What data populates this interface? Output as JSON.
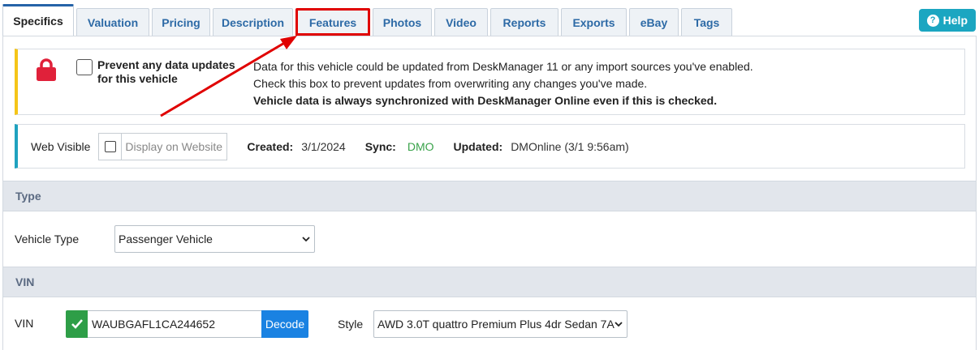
{
  "tabs": [
    {
      "label": "Specifics"
    },
    {
      "label": "Valuation"
    },
    {
      "label": "Pricing"
    },
    {
      "label": "Description"
    },
    {
      "label": "Features"
    },
    {
      "label": "Photos"
    },
    {
      "label": "Video"
    },
    {
      "label": "Reports"
    },
    {
      "label": "Exports"
    },
    {
      "label": "eBay"
    },
    {
      "label": "Tags"
    }
  ],
  "help": {
    "label": "Help",
    "icon": "question-icon"
  },
  "prevent": {
    "label": "Prevent any data updates for this vehicle",
    "desc_line1": "Data for this vehicle could be updated from DeskManager 11 or any import sources you've enabled.",
    "desc_line2": "Check this box to prevent updates from overwriting any changes you've made.",
    "desc_line3": "Vehicle data is always synchronized with DeskManager Online even if this is checked.",
    "accent_color": "#f5c518",
    "icon_color": "#e0213a"
  },
  "info": {
    "web_visible_label": "Web Visible",
    "display_placeholder": "Display on Website",
    "created_label": "Created:",
    "created_value": "3/1/2024",
    "sync_label": "Sync:",
    "sync_value": "DMO",
    "updated_label": "Updated:",
    "updated_value": "DMOnline (3/1 9:56am)",
    "accent_color": "#1fa2bf"
  },
  "type_section": {
    "title": "Type",
    "vehicle_type_label": "Vehicle Type",
    "vehicle_type_value": "Passenger Vehicle"
  },
  "vin_section": {
    "title": "VIN",
    "vin_label": "VIN",
    "vin_value": "WAUBGAFL1CA244652",
    "decode_label": "Decode",
    "style_label": "Style",
    "style_value": "AWD 3.0T quattro Premium Plus 4dr Sedan 7A"
  },
  "annotation": {
    "color": "#e00000"
  }
}
